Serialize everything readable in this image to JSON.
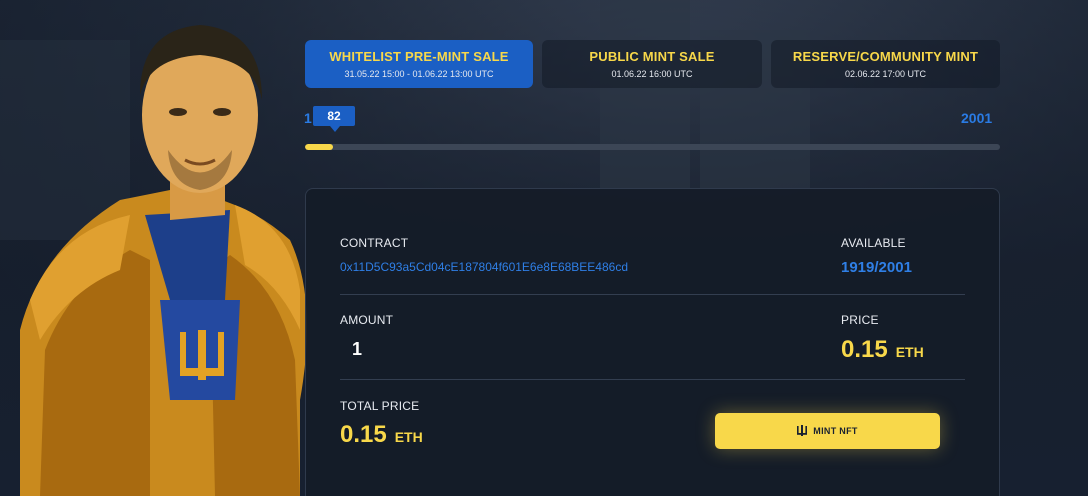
{
  "phases": [
    {
      "title": "WHITELIST PRE-MINT SALE",
      "date": "31.05.22 15:00 - 01.06.22 13:00 UTC",
      "active": true
    },
    {
      "title": "PUBLIC MINT SALE",
      "date": "01.06.22 16:00 UTC",
      "active": false
    },
    {
      "title": "RESERVE/COMMUNITY MINT",
      "date": "02.06.22 17:00 UTC",
      "active": false
    }
  ],
  "progress": {
    "start": "1",
    "current": "82",
    "end": "2001",
    "fraction": 0.041
  },
  "mint": {
    "contract_label": "CONTRACT",
    "contract_address": "0x11D5C93a5Cd04cE187804f601E6e8E68BEE486cd",
    "available_label": "AVAILABLE",
    "available_value": "1919/2001",
    "amount_label": "AMOUNT",
    "amount_value": "1",
    "price_label": "PRICE",
    "price_value": "0.15",
    "price_unit": "ETH",
    "total_label": "TOTAL PRICE",
    "total_value": "0.15",
    "total_unit": "ETH",
    "button_label": "MINT NFT",
    "button_icon": "trident-icon"
  },
  "colors": {
    "accent_yellow": "#f8d84a",
    "accent_blue": "#1b5fc4",
    "background": "#17202e"
  }
}
